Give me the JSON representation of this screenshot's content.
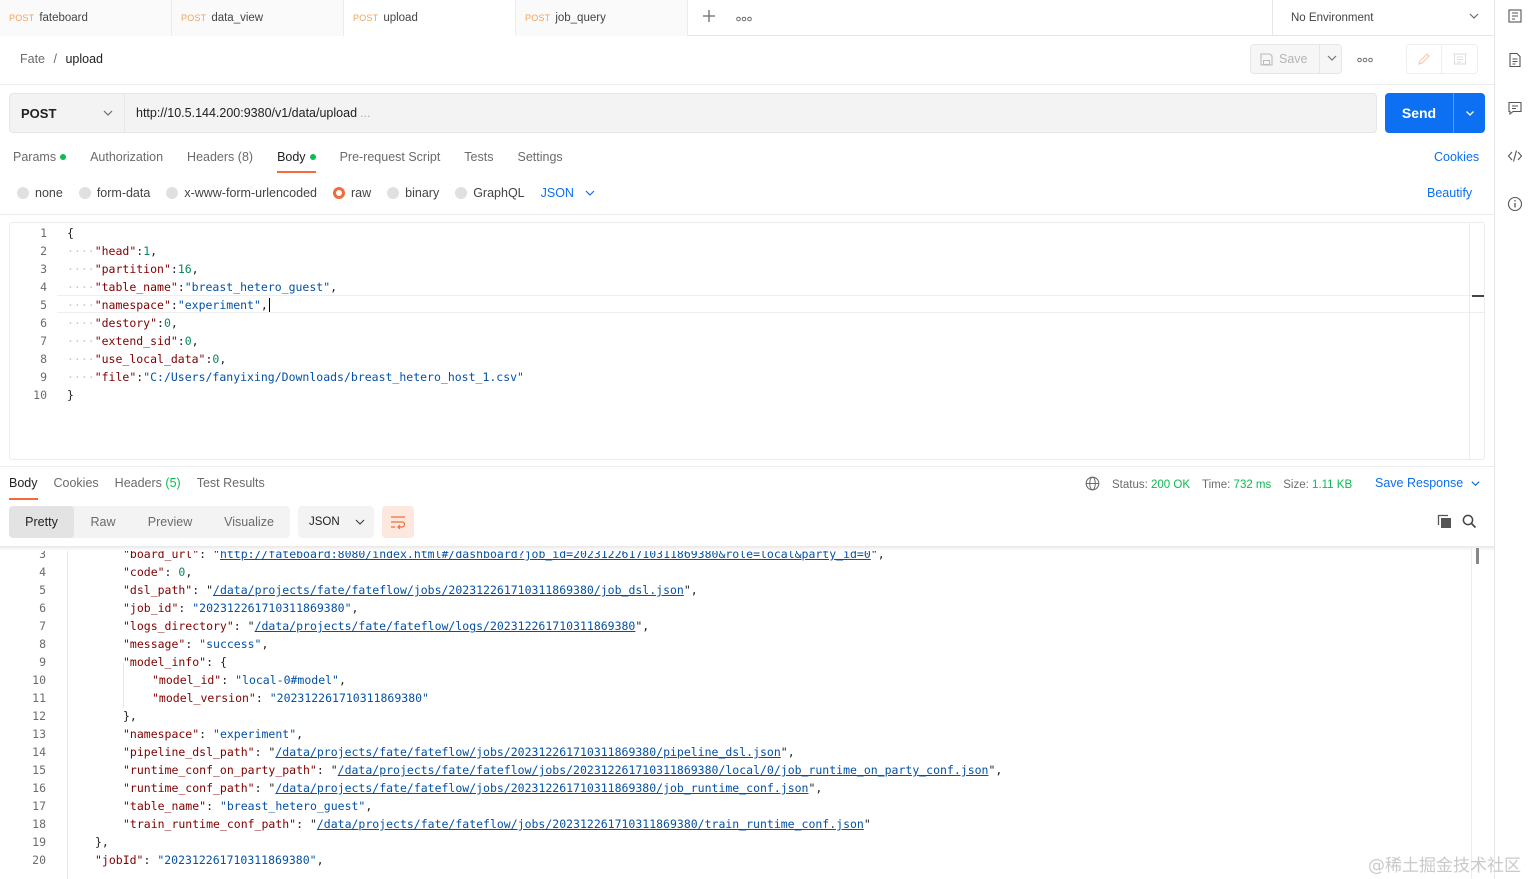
{
  "tabs": [
    {
      "method": "POST",
      "name": "fateboard"
    },
    {
      "method": "POST",
      "name": "data_view"
    },
    {
      "method": "POST",
      "name": "upload"
    },
    {
      "method": "POST",
      "name": "job_query"
    }
  ],
  "environment": "No Environment",
  "breadcrumb": {
    "collection": "Fate",
    "separator": "/",
    "request": "upload"
  },
  "toolbar": {
    "save_label": "Save",
    "more": "ooo"
  },
  "request": {
    "method": "POST",
    "url": "http://10.5.144.200:9380/v1/data/upload",
    "url_ellipsis": "...",
    "send_label": "Send"
  },
  "request_tabs": {
    "params": "Params",
    "authorization": "Authorization",
    "headers": "Headers",
    "headers_count": "(8)",
    "body": "Body",
    "prerequest": "Pre-request Script",
    "tests": "Tests",
    "settings": "Settings",
    "cookies": "Cookies"
  },
  "body_types": {
    "none": "none",
    "form_data": "form-data",
    "urlencoded": "x-www-form-urlencoded",
    "raw": "raw",
    "binary": "binary",
    "graphql": "GraphQL",
    "format": "JSON",
    "beautify": "Beautify"
  },
  "request_body": {
    "line_numbers": [
      "1",
      "2",
      "3",
      "4",
      "5",
      "6",
      "7",
      "8",
      "9",
      "10"
    ],
    "open": "{",
    "close": "}",
    "indent": "····",
    "k_head": "\"head\"",
    "v_head": "1",
    "k_partition": "\"partition\"",
    "v_partition": "16",
    "k_table_name": "\"table_name\"",
    "v_table_name": "\"breast_hetero_guest\"",
    "k_namespace": "\"namespace\"",
    "v_namespace": "\"experiment\"",
    "k_destory": "\"destory\"",
    "v_destory": "0",
    "k_extend_sid": "\"extend_sid\"",
    "v_extend_sid": "0",
    "k_use_local_data": "\"use_local_data\"",
    "v_use_local_data": "0",
    "k_file": "\"file\"",
    "v_file": "\"C:/Users/fanyixing/Downloads/breast_hetero_host_1.csv\""
  },
  "response_tabs": {
    "body": "Body",
    "cookies": "Cookies",
    "headers": "Headers",
    "headers_count": "(5)",
    "test_results": "Test Results"
  },
  "response_status": {
    "status_label": "Status:",
    "status": "200 OK",
    "time_label": "Time:",
    "time": "732 ms",
    "size_label": "Size:",
    "size": "1.11 KB",
    "save_response": "Save Response"
  },
  "view_modes": {
    "pretty": "Pretty",
    "raw": "Raw",
    "preview": "Preview",
    "visualize": "Visualize",
    "format": "JSON"
  },
  "response_body": {
    "line_numbers": [
      "3",
      "4",
      "5",
      "6",
      "7",
      "8",
      "9",
      "10",
      "11",
      "12",
      "13",
      "14",
      "15",
      "16",
      "17",
      "18",
      "19",
      "20"
    ],
    "k_board_url": "\"board_url\"",
    "v_board_url": "http://fateboard:8080/index.html#/dashboard?job_id=202312261710311869380&role=local&party_id=0",
    "k_code": "\"code\"",
    "v_code": "0",
    "k_dsl_path": "\"dsl_path\"",
    "v_dsl_path": "/data/projects/fate/fateflow/jobs/202312261710311869380/job_dsl.json",
    "k_job_id": "\"job_id\"",
    "v_job_id": "\"202312261710311869380\"",
    "k_logs_directory": "\"logs_directory\"",
    "v_logs_directory": "/data/projects/fate/fateflow/logs/202312261710311869380",
    "k_message": "\"message\"",
    "v_message": "\"success\"",
    "k_model_info": "\"model_info\"",
    "k_model_id": "\"model_id\"",
    "v_model_id": "\"local-0#model\"",
    "k_model_version": "\"model_version\"",
    "v_model_version": "\"202312261710311869380\"",
    "k_namespace": "\"namespace\"",
    "v_namespace": "\"experiment\"",
    "k_pipeline_dsl_path": "\"pipeline_dsl_path\"",
    "v_pipeline_dsl_path": "/data/projects/fate/fateflow/jobs/202312261710311869380/pipeline_dsl.json",
    "k_runtime_conf_on_party_path": "\"runtime_conf_on_party_path\"",
    "v_runtime_conf_on_party_path": "/data/projects/fate/fateflow/jobs/202312261710311869380/local/0/job_runtime_on_party_conf.json",
    "k_runtime_conf_path": "\"runtime_conf_path\"",
    "v_runtime_conf_path": "/data/projects/fate/fateflow/jobs/202312261710311869380/job_runtime_conf.json",
    "k_table_name": "\"table_name\"",
    "v_table_name": "\"breast_hetero_guest\"",
    "k_train_runtime_conf_path": "\"train_runtime_conf_path\"",
    "v_train_runtime_conf_path": "/data/projects/fate/fateflow/jobs/202312261710311869380/train_runtime_conf.json",
    "k_jobId": "\"jobId\"",
    "v_jobId": "\"202312261710311869380\""
  },
  "watermark": "@稀土掘金技术社区",
  "colors": {
    "accent_blue": "#0d6ff1",
    "method_orange": "#f0a35f",
    "active_underline": "#f26b3a",
    "status_green": "#0cbb52",
    "json_key": "#800000",
    "json_string": "#0451a5",
    "json_number": "#098658"
  }
}
